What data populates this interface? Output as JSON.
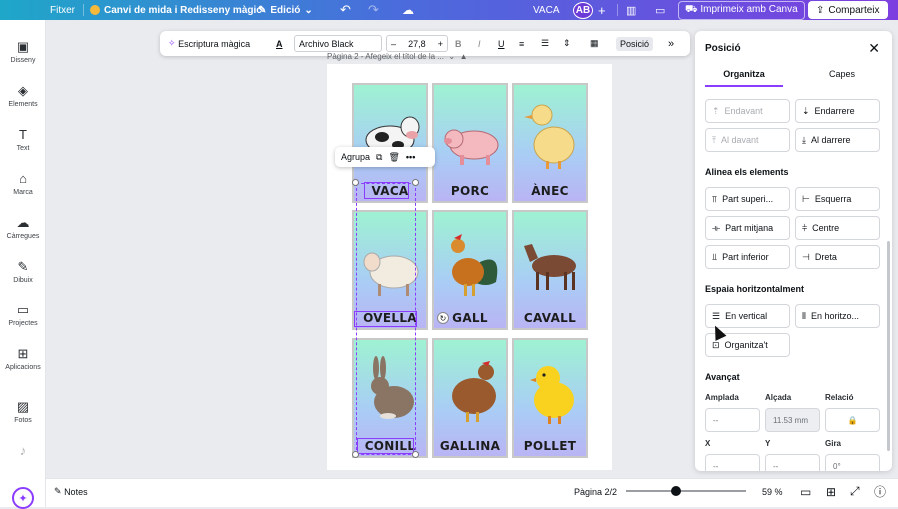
{
  "topbar": {
    "file_label": "Fitxer",
    "design_title": "Canvi de mida i Redisseny màgic",
    "edit_label": "Edició",
    "doc_name": "VACA",
    "avatar_initials": "AB",
    "print_label": "Imprimeix amb Canva",
    "share_label": "Comparteix"
  },
  "sidebar": {
    "items": [
      {
        "label": "Disseny",
        "icon": "layout-icon"
      },
      {
        "label": "Elements",
        "icon": "shapes-icon"
      },
      {
        "label": "Text",
        "icon": "text-icon"
      },
      {
        "label": "Marca",
        "icon": "brand-icon"
      },
      {
        "label": "Càrregues",
        "icon": "upload-icon"
      },
      {
        "label": "Dibuix",
        "icon": "pen-icon"
      },
      {
        "label": "Projectes",
        "icon": "folder-icon"
      },
      {
        "label": "Aplicacions",
        "icon": "apps-icon"
      },
      {
        "label": "Fotos",
        "icon": "photo-icon"
      }
    ]
  },
  "toolbar": {
    "magic_write": "Escriptura màgica",
    "font_name": "Archivo Black",
    "font_size": "27,8",
    "position_label": "Posició"
  },
  "canvas": {
    "page_label": "Pàgina 2 - Afegeix el títol de la ...",
    "context_group": "Agrupa",
    "cards": [
      {
        "label": "VACA",
        "animal": "cow"
      },
      {
        "label": "PORC",
        "animal": "pig"
      },
      {
        "label": "ÀNEC",
        "animal": "duck"
      },
      {
        "label": "OVELLA",
        "animal": "sheep"
      },
      {
        "label": "GALL",
        "animal": "rooster"
      },
      {
        "label": "CAVALL",
        "animal": "horse"
      },
      {
        "label": "CONILL",
        "animal": "rabbit"
      },
      {
        "label": "GALLINA",
        "animal": "hen"
      },
      {
        "label": "POLLET",
        "animal": "chick"
      }
    ]
  },
  "panel": {
    "title": "Posició",
    "tabs": [
      "Organitza",
      "Capes"
    ],
    "arrange": {
      "forward": "Endavant",
      "backward": "Endarrere",
      "to_front": "Al davant",
      "to_back": "Al darrere"
    },
    "align_title": "Alinea els elements",
    "align": {
      "top": "Part superi...",
      "left": "Esquerra",
      "middle": "Part mitjana",
      "center": "Centre",
      "bottom": "Part inferior",
      "right": "Dreta"
    },
    "space_title": "Espaia horitzontalment",
    "space": {
      "vertical": "En vertical",
      "horizontal": "En horitzo...",
      "tidy": "Organitza't"
    },
    "advanced_title": "Avançat",
    "fields": {
      "width_label": "Amplada",
      "width_value": "--",
      "height_label": "Alçada",
      "height_value": "11.53 mm",
      "ratio_label": "Relació",
      "x_label": "X",
      "x_value": "--",
      "y_label": "Y",
      "y_value": "--",
      "rotate_label": "Gira",
      "rotate_value": "0°"
    }
  },
  "bottombar": {
    "notes_label": "Notes",
    "page_counter": "Pàgina 2/2",
    "zoom": "59 %",
    "zoom_fraction": 0.42
  }
}
